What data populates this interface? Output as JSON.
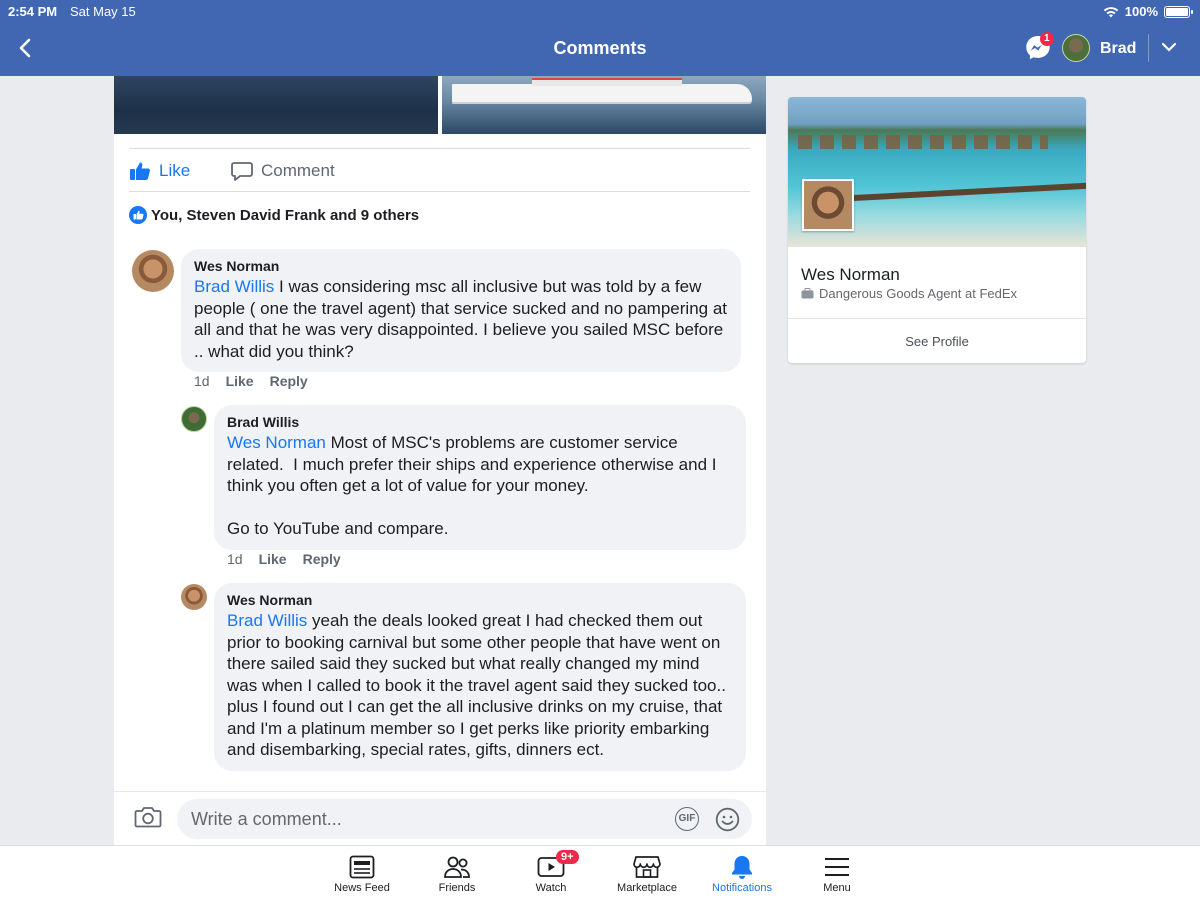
{
  "status_bar": {
    "time": "2:54 PM",
    "date": "Sat May 15",
    "battery": "100%"
  },
  "header": {
    "title": "Comments",
    "messenger_badge": "1",
    "user_name": "Brad"
  },
  "post_actions": {
    "like_label": "Like",
    "comment_label": "Comment"
  },
  "reactions": {
    "text": "You, Steven David Frank and 9 others"
  },
  "comments": [
    {
      "author": "Wes Norman",
      "mention": "Brad Willis",
      "text": " I was considering msc all inclusive but was told by a few people ( one the travel agent) that service sucked and no pampering at all and that he was very disappointed. I believe you sailed MSC before .. what did you think?",
      "time": "1d",
      "like": "Like",
      "reply": "Reply"
    },
    {
      "author": "Brad Willis",
      "mention": "Wes Norman",
      "text": " Most of MSC's problems are customer service related.  I much prefer their ships and experience otherwise and I think you often get a lot of value for your money.\n\nGo to YouTube and compare.",
      "time": "1d",
      "like": "Like",
      "reply": "Reply"
    },
    {
      "author": "Wes Norman",
      "mention": "Brad Willis",
      "text": " yeah the deals looked great I had checked them out prior to booking carnival but some other people that have went on there sailed said they sucked but what really changed my mind was when I called to book it the travel agent said they sucked too.. plus I found out I can get the all inclusive drinks on my cruise, that and I'm a platinum member so I get perks like priority embarking and disembarking, special rates, gifts, dinners ect."
    }
  ],
  "composer": {
    "placeholder": "Write a comment...",
    "gif_label": "GIF"
  },
  "profile_card": {
    "name": "Wes Norman",
    "subtitle": "Dangerous Goods Agent at FedEx",
    "button": "See Profile"
  },
  "tabs": [
    {
      "label": "News Feed",
      "icon": "news-feed-icon"
    },
    {
      "label": "Friends",
      "icon": "friends-icon"
    },
    {
      "label": "Watch",
      "icon": "watch-icon",
      "badge": "9+"
    },
    {
      "label": "Marketplace",
      "icon": "marketplace-icon"
    },
    {
      "label": "Notifications",
      "icon": "bell-icon",
      "active": true
    },
    {
      "label": "Menu",
      "icon": "menu-icon"
    }
  ],
  "colors": {
    "brand": "#4267b2",
    "link": "#1877f2",
    "badge": "#f02849"
  }
}
